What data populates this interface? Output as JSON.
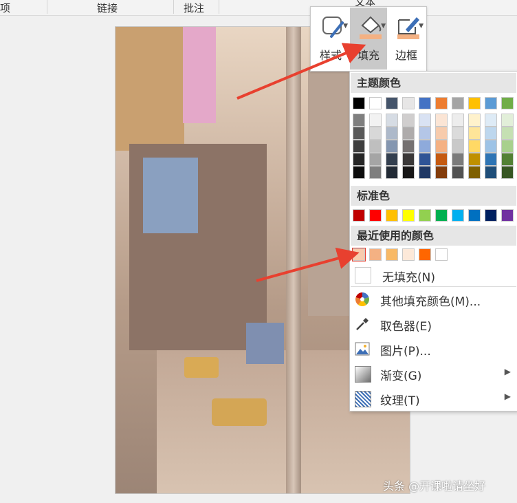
{
  "ribbon": {
    "items": [
      "项",
      "链接",
      "批注",
      "文本"
    ]
  },
  "mini_toolbar": {
    "style_label": "样式",
    "fill_label": "填充",
    "border_label": "边框"
  },
  "panel": {
    "theme_colors_heading": "主题颜色",
    "standard_colors_heading": "标准色",
    "recent_colors_heading": "最近使用的颜色",
    "no_fill_label": "无填充(N)",
    "more_fill_label": "其他填充颜色(M)...",
    "eyedropper_label": "取色器(E)",
    "picture_label": "图片(P)...",
    "gradient_label": "渐变(G)",
    "texture_label": "纹理(T)",
    "theme_top_row": [
      "#000000",
      "#ffffff",
      "#44546a",
      "#e7e6e6",
      "#4472c4",
      "#ed7d31",
      "#a5a5a5",
      "#ffc000",
      "#5b9bd5",
      "#70ad47"
    ],
    "theme_shades": [
      [
        "#7f7f7f",
        "#595959",
        "#3f3f3f",
        "#262626",
        "#0d0d0d"
      ],
      [
        "#f2f2f2",
        "#d8d8d8",
        "#bfbfbf",
        "#a5a5a5",
        "#7f7f7f"
      ],
      [
        "#d6dce4",
        "#adb9ca",
        "#8496b0",
        "#333f4f",
        "#222a35"
      ],
      [
        "#d0cece",
        "#aeabab",
        "#757171",
        "#3a3838",
        "#171616"
      ],
      [
        "#d9e2f3",
        "#b4c6e7",
        "#8eaadb",
        "#2f5496",
        "#1f3864"
      ],
      [
        "#fbe5d5",
        "#f7cbac",
        "#f4b183",
        "#c55a11",
        "#833c0b"
      ],
      [
        "#ededed",
        "#dbdbdb",
        "#c9c9c9",
        "#7b7b7b",
        "#525252"
      ],
      [
        "#fff2cc",
        "#fee599",
        "#ffd965",
        "#bf9000",
        "#7f6000"
      ],
      [
        "#deebf6",
        "#bdd7ee",
        "#9dc3e6",
        "#2e75b5",
        "#1f4e79"
      ],
      [
        "#e2efd9",
        "#c5e0b3",
        "#a8d08d",
        "#538135",
        "#375623"
      ]
    ],
    "standard_colors": [
      "#c00000",
      "#ff0000",
      "#ffc000",
      "#ffff00",
      "#92d050",
      "#00b050",
      "#00b0f0",
      "#0070c0",
      "#002060",
      "#7030a0"
    ],
    "recent_colors": [
      "#f8cbad",
      "#f4b183",
      "#f8b966",
      "#fde9d9",
      "#ff6600",
      "#ffffff"
    ]
  },
  "watermark": "头条 @开课啦请坐好"
}
